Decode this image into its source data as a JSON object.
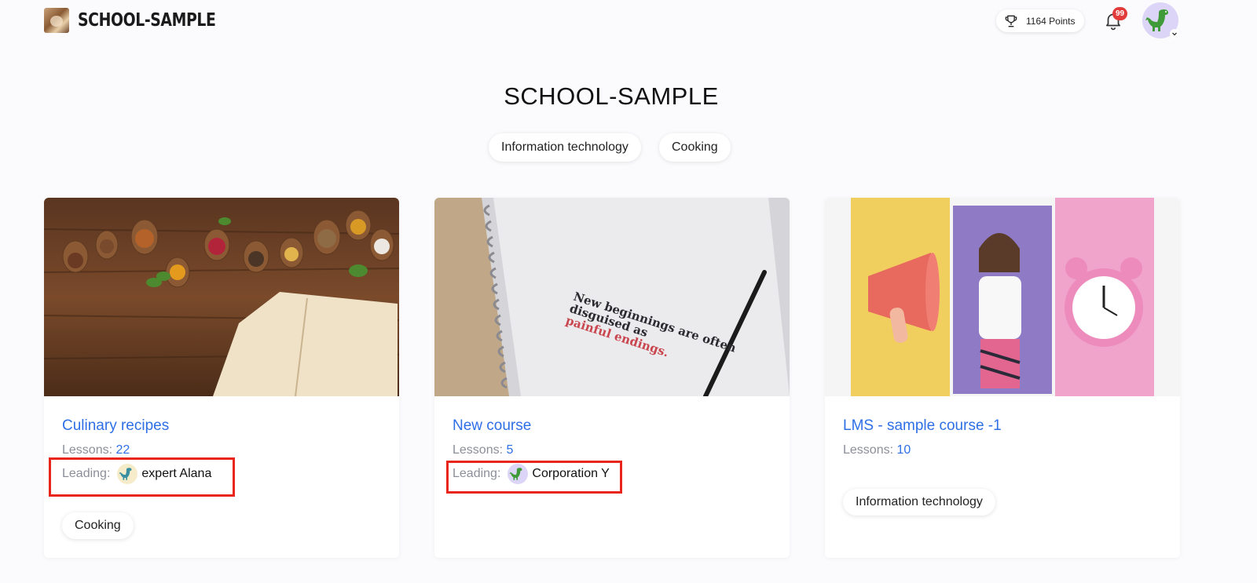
{
  "header": {
    "brand": "SCHOOL-SAMPLE",
    "points_label": "1164 Points",
    "notifications_count": "99"
  },
  "page": {
    "title": "SCHOOL-SAMPLE",
    "filters": [
      "Information technology",
      "Cooking"
    ]
  },
  "courses": [
    {
      "title": "Culinary recipes",
      "lessons_label": "Lessons:",
      "lessons_count": "22",
      "leading_label": "Leading:",
      "leader": "expert Alana",
      "tag": "Cooking"
    },
    {
      "title": "New course",
      "lessons_label": "Lessons:",
      "lessons_count": "5",
      "leading_label": "Leading:",
      "leader": "Corporation Y",
      "image_text": [
        "New beginnings are often",
        "disguised as",
        "painful endings."
      ]
    },
    {
      "title": "LMS - sample course -1",
      "lessons_label": "Lessons:",
      "lessons_count": "10",
      "tag": "Information technology"
    }
  ],
  "colors": {
    "accent": "#2f6fe6",
    "badge": "#e23b3b",
    "highlight": "#e8261c"
  }
}
